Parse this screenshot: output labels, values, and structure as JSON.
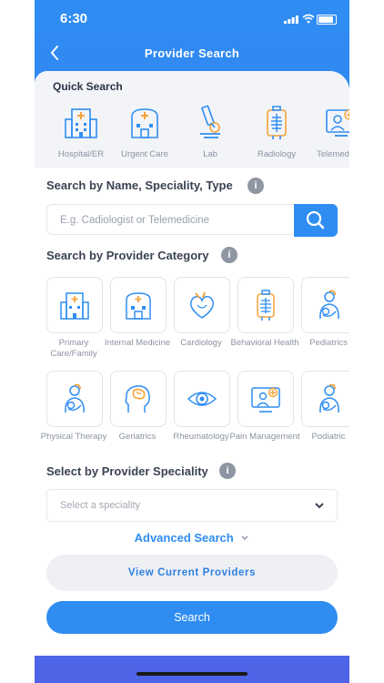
{
  "status": {
    "time": "6:30"
  },
  "header": {
    "title": "Provider Search"
  },
  "quick_search": {
    "title": "Quick Search",
    "items": [
      {
        "label": "Hospital/ER",
        "icon": "hospital-icon"
      },
      {
        "label": "Urgent Care",
        "icon": "urgent-care-icon"
      },
      {
        "label": "Lab",
        "icon": "microscope-icon"
      },
      {
        "label": "Radiology",
        "icon": "xray-icon"
      },
      {
        "label": "Telemed",
        "icon": "telemedicine-icon"
      }
    ]
  },
  "search": {
    "title": "Search by Name, Speciality, Type",
    "placeholder": "E.g. Cadiologist or Telemedicine"
  },
  "category": {
    "title": "Search by Provider Category",
    "items": [
      {
        "label": "Primary Care/Family",
        "icon": "hospital-icon"
      },
      {
        "label": "Internal Medicine",
        "icon": "hospital-icon"
      },
      {
        "label": "Cardiology",
        "icon": "heart-icon"
      },
      {
        "label": "Behavioral Health",
        "icon": "xray-icon"
      },
      {
        "label": "Pediatrics",
        "icon": "mother-baby-icon"
      },
      {
        "label": "Physical Therapy",
        "icon": "mother-baby-icon"
      },
      {
        "label": "Geriatrics",
        "icon": "brain-icon"
      },
      {
        "label": "Rheumatology",
        "icon": "eye-icon"
      },
      {
        "label": "Pain Management",
        "icon": "telemedicine-icon"
      },
      {
        "label": "Podiatric",
        "icon": "mother-baby-icon"
      }
    ]
  },
  "speciality": {
    "title": "Select by Provider Speciality",
    "placeholder": "Select a speciality"
  },
  "advanced": {
    "label": "Advanced Search"
  },
  "buttons": {
    "view_current": "View Current Providers",
    "search": "Search"
  },
  "colors": {
    "primary": "#2f8df2",
    "icon_orange": "#f5a23a",
    "text_dark": "#3b4352",
    "text_muted": "#8c93a0"
  }
}
